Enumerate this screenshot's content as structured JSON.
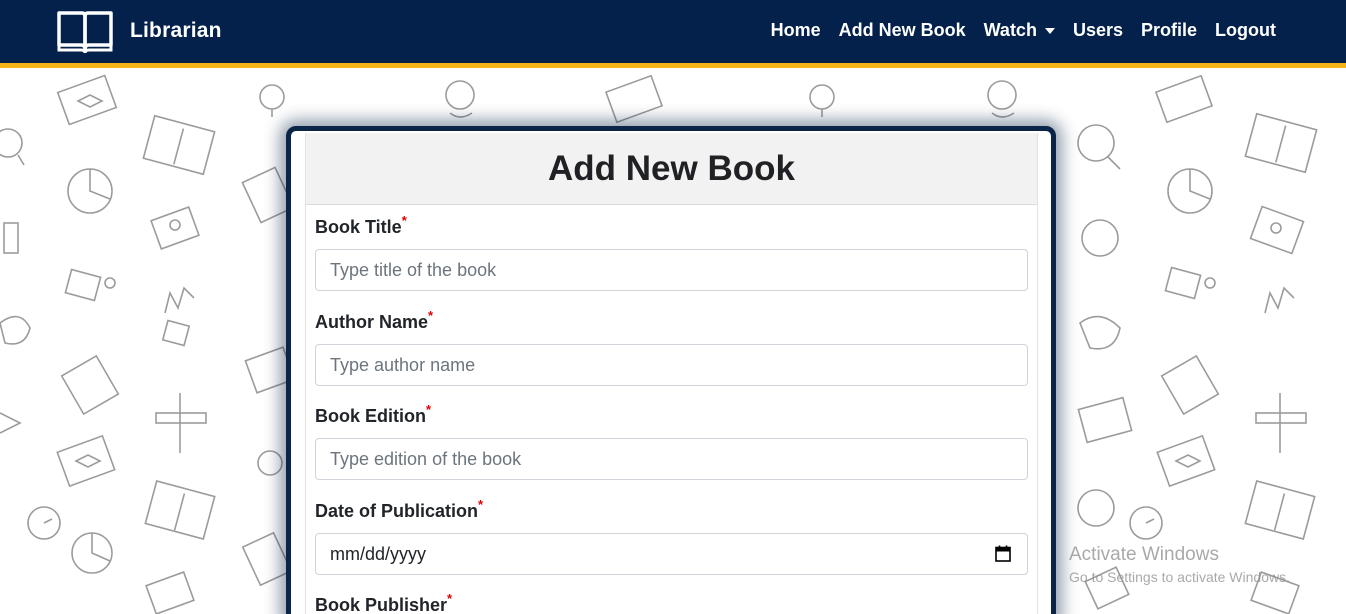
{
  "navbar": {
    "brand": "Librarian",
    "links": [
      {
        "label": "Home"
      },
      {
        "label": "Add New Book"
      },
      {
        "label": "Watch"
      },
      {
        "label": "Users"
      },
      {
        "label": "Profile"
      },
      {
        "label": "Logout"
      }
    ],
    "bg_color": "#03214a",
    "accent_color": "#f2b418"
  },
  "form": {
    "title": "Add New Book",
    "fields": [
      {
        "label": "Book Title",
        "required_mark": "*",
        "placeholder": "Type title of the book"
      },
      {
        "label": "Author Name",
        "required_mark": "*",
        "placeholder": "Type author name"
      },
      {
        "label": "Book Edition",
        "required_mark": "*",
        "placeholder": "Type edition of the book"
      },
      {
        "label": "Date of Publication",
        "required_mark": "*",
        "value": "mm/dd/yyyy",
        "icon": "calendar-icon"
      },
      {
        "label": "Book Publisher",
        "required_mark": "*"
      }
    ]
  },
  "watermark": {
    "title": "Activate Windows",
    "subtitle": "Go to Settings to activate Windows."
  }
}
